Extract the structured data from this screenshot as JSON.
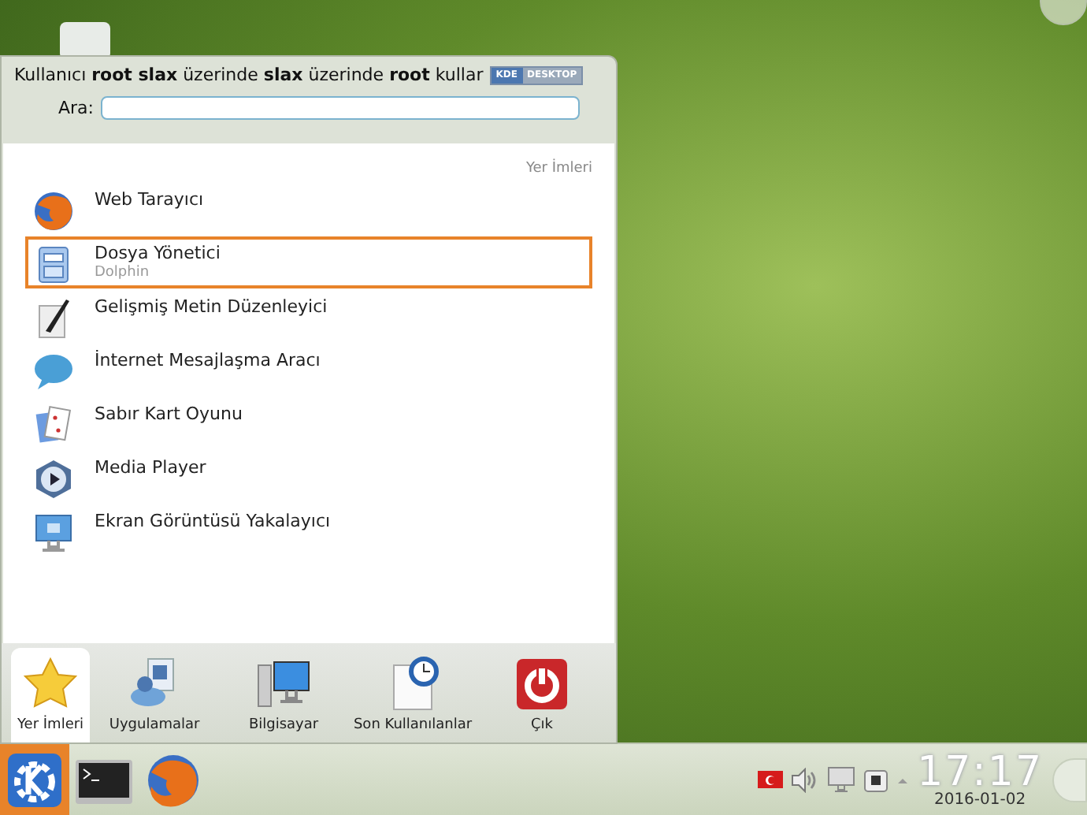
{
  "menu": {
    "header": "Kullanıcı **root slax** üzerinde **slax** üzerinde **root** kullar",
    "badge": [
      "KDE",
      "DESKTOP"
    ],
    "search": {
      "label": "Ara:"
    },
    "section_title": "Yer İmleri",
    "items": [
      {
        "title": "Web Tarayıcı",
        "selected": false
      },
      {
        "title": "Dosya Yönetici",
        "subtitle": "Dolphin",
        "selected": true
      },
      {
        "title": "Gelişmiş Metin Düzenleyici",
        "selected": false
      },
      {
        "title": "İnternet Mesajlaşma Aracı",
        "selected": false
      },
      {
        "title": "Sabır Kart Oyunu",
        "selected": false
      },
      {
        "title": "Media Player",
        "selected": false
      },
      {
        "title": "Ekran Görüntüsü Yakalayıcı",
        "selected": false
      }
    ],
    "tabs": [
      {
        "label": "Yer İmleri",
        "selected": true
      },
      {
        "label": "Uygulamalar",
        "selected": false
      },
      {
        "label": "Bilgisayar",
        "selected": false
      },
      {
        "label": "Son Kullanılanlar",
        "selected": false
      },
      {
        "label": "Çık",
        "selected": false
      }
    ]
  },
  "taskbar": {
    "launchers": [
      {
        "selected": true
      },
      {
        "selected": false
      },
      {
        "selected": false
      }
    ],
    "clock": {
      "time": "17:17",
      "date": "2016-01-02"
    }
  }
}
